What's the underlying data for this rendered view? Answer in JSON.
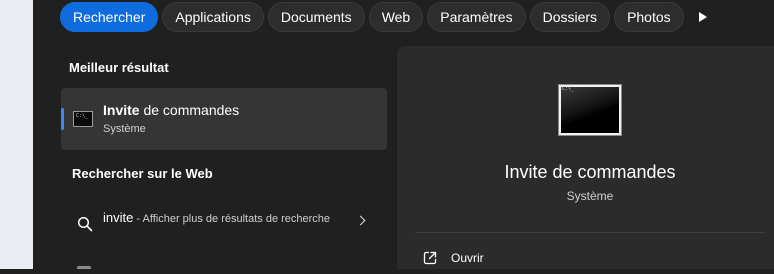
{
  "tabs": [
    {
      "label": "Rechercher",
      "active": true
    },
    {
      "label": "Applications"
    },
    {
      "label": "Documents"
    },
    {
      "label": "Web"
    },
    {
      "label": "Paramètres"
    },
    {
      "label": "Dossiers"
    },
    {
      "label": "Photos"
    }
  ],
  "more_tabs_icon": "play-icon",
  "best_match": {
    "section_title": "Meilleur résultat",
    "title_bold": "Invite",
    "title_rest": " de commandes",
    "subtitle": "Système",
    "icon": "command-prompt-icon",
    "cmd_glyph": "C:\\_"
  },
  "web_search": {
    "section_title": "Rechercher sur le Web",
    "query": "invite",
    "suggestion": " - Afficher plus de résultats de recherche",
    "icon": "search-icon"
  },
  "preview": {
    "title": "Invite de commandes",
    "subtitle": "Système",
    "actions": [
      {
        "label": "Ouvrir",
        "icon": "open-external-icon"
      }
    ]
  },
  "colors": {
    "accent": "#0f6cde",
    "panel_bg": "#202020",
    "preview_bg": "#2b2b2b",
    "selected_bg": "#353535"
  }
}
